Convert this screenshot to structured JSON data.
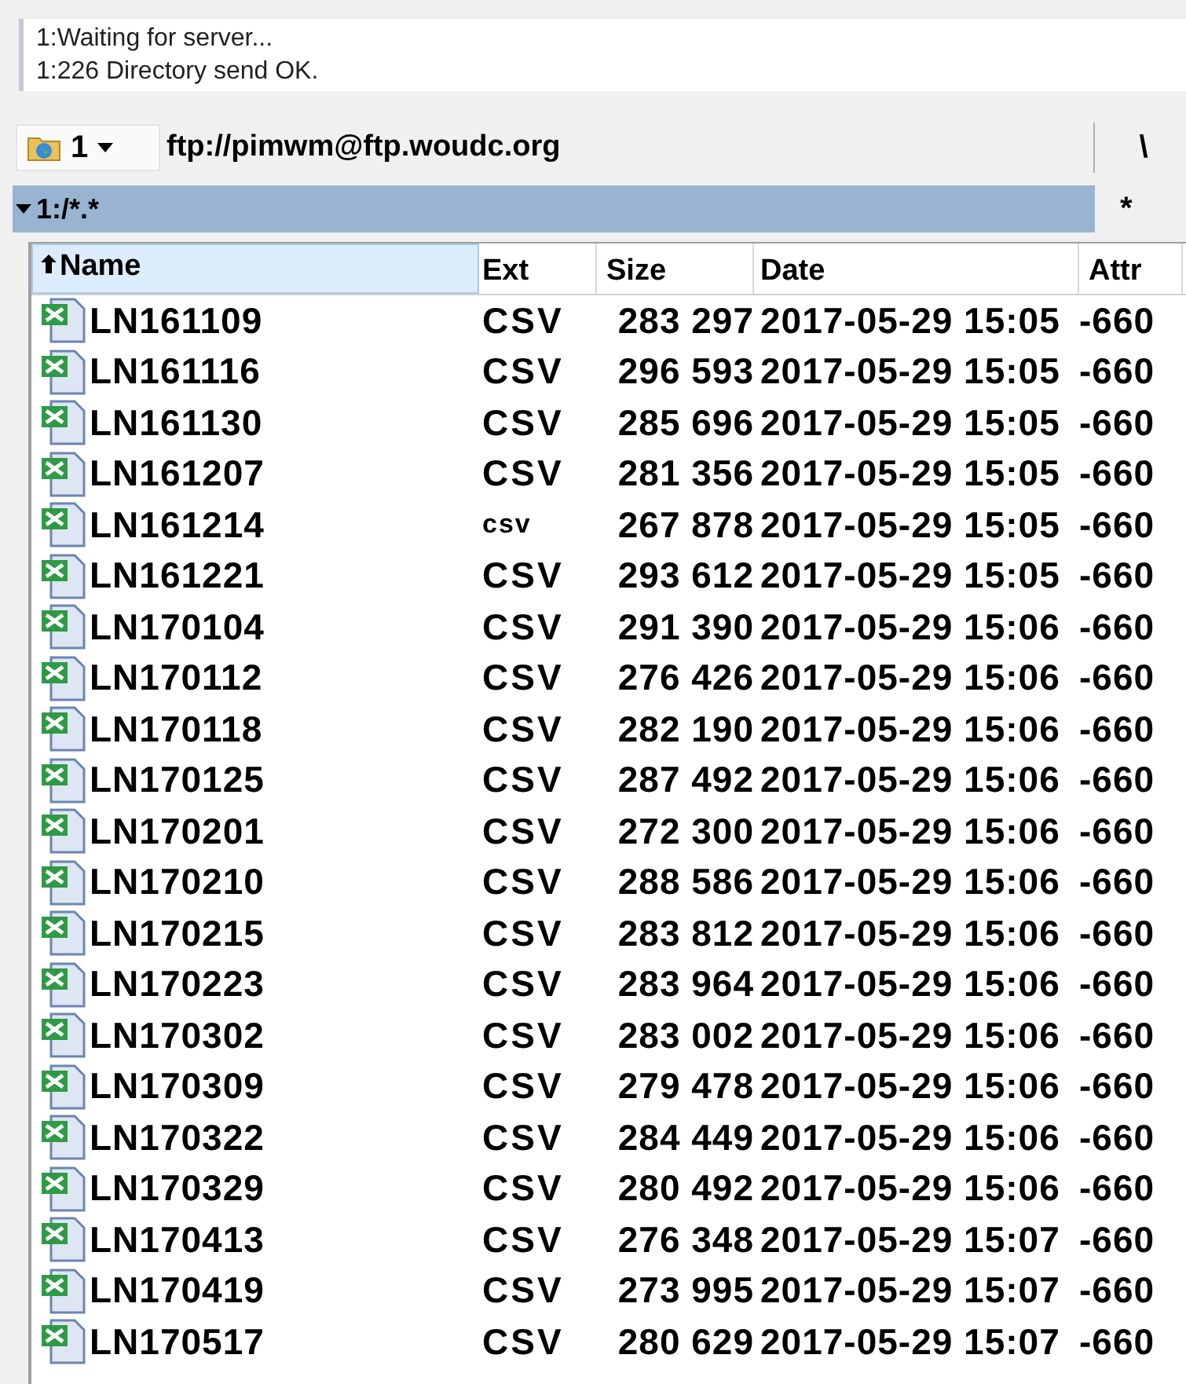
{
  "log": [
    "1:Waiting for server...",
    "1:226 Directory send OK."
  ],
  "toolbar": {
    "drive": "1",
    "path": "ftp://pimwm@ftp.woudc.org",
    "root_button": "\\"
  },
  "filter_bar": {
    "filter": "1:/*.*",
    "side_button": "*"
  },
  "table": {
    "columns": [
      {
        "label": "Name",
        "sorted": true
      },
      {
        "label": "Ext",
        "sorted": false
      },
      {
        "label": "Size",
        "sorted": false
      },
      {
        "label": "Date",
        "sorted": false
      },
      {
        "label": "Attr",
        "sorted": false
      }
    ],
    "rows": [
      {
        "name": "LN161109",
        "ext": "CSV",
        "size": "283 297",
        "date": "2017-05-29 15:05",
        "attr": "-660"
      },
      {
        "name": "LN161116",
        "ext": "CSV",
        "size": "296 593",
        "date": "2017-05-29 15:05",
        "attr": "-660"
      },
      {
        "name": "LN161130",
        "ext": "CSV",
        "size": "285 696",
        "date": "2017-05-29 15:05",
        "attr": "-660"
      },
      {
        "name": "LN161207",
        "ext": "CSV",
        "size": "281 356",
        "date": "2017-05-29 15:05",
        "attr": "-660"
      },
      {
        "name": "LN161214",
        "ext": "csv",
        "size": "267 878",
        "date": "2017-05-29 15:05",
        "attr": "-660"
      },
      {
        "name": "LN161221",
        "ext": "CSV",
        "size": "293 612",
        "date": "2017-05-29 15:05",
        "attr": "-660"
      },
      {
        "name": "LN170104",
        "ext": "CSV",
        "size": "291 390",
        "date": "2017-05-29 15:06",
        "attr": "-660"
      },
      {
        "name": "LN170112",
        "ext": "CSV",
        "size": "276 426",
        "date": "2017-05-29 15:06",
        "attr": "-660"
      },
      {
        "name": "LN170118",
        "ext": "CSV",
        "size": "282 190",
        "date": "2017-05-29 15:06",
        "attr": "-660"
      },
      {
        "name": "LN170125",
        "ext": "CSV",
        "size": "287 492",
        "date": "2017-05-29 15:06",
        "attr": "-660"
      },
      {
        "name": "LN170201",
        "ext": "CSV",
        "size": "272 300",
        "date": "2017-05-29 15:06",
        "attr": "-660"
      },
      {
        "name": "LN170210",
        "ext": "CSV",
        "size": "288 586",
        "date": "2017-05-29 15:06",
        "attr": "-660"
      },
      {
        "name": "LN170215",
        "ext": "CSV",
        "size": "283 812",
        "date": "2017-05-29 15:06",
        "attr": "-660"
      },
      {
        "name": "LN170223",
        "ext": "CSV",
        "size": "283 964",
        "date": "2017-05-29 15:06",
        "attr": "-660"
      },
      {
        "name": "LN170302",
        "ext": "CSV",
        "size": "283 002",
        "date": "2017-05-29 15:06",
        "attr": "-660"
      },
      {
        "name": "LN170309",
        "ext": "CSV",
        "size": "279 478",
        "date": "2017-05-29 15:06",
        "attr": "-660"
      },
      {
        "name": "LN170322",
        "ext": "CSV",
        "size": "284 449",
        "date": "2017-05-29 15:06",
        "attr": "-660"
      },
      {
        "name": "LN170329",
        "ext": "CSV",
        "size": "280 492",
        "date": "2017-05-29 15:06",
        "attr": "-660"
      },
      {
        "name": "LN170413",
        "ext": "CSV",
        "size": "276 348",
        "date": "2017-05-29 15:07",
        "attr": "-660"
      },
      {
        "name": "LN170419",
        "ext": "CSV",
        "size": "273 995",
        "date": "2017-05-29 15:07",
        "attr": "-660"
      },
      {
        "name": "LN170517",
        "ext": "CSV",
        "size": "280 629",
        "date": "2017-05-29 15:07",
        "attr": "-660"
      }
    ]
  }
}
